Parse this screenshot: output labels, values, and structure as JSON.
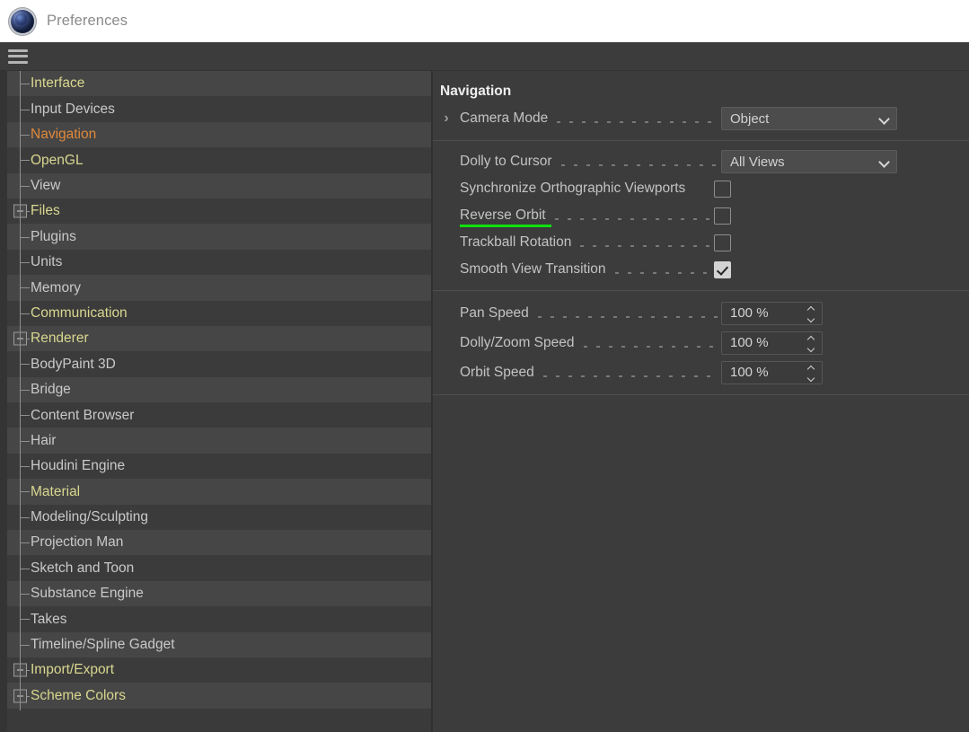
{
  "window": {
    "title": "Preferences",
    "logo_icon": "cinema4d-sphere-icon",
    "menu_icon": "hamburger-menu-icon"
  },
  "sidebar": {
    "items": [
      {
        "label": "Interface",
        "color_class": "c-yellow",
        "expandable": false,
        "selected": false
      },
      {
        "label": "Input Devices",
        "color_class": "c-plain",
        "expandable": false,
        "selected": false
      },
      {
        "label": "Navigation",
        "color_class": "c-sel",
        "expandable": false,
        "selected": true
      },
      {
        "label": "OpenGL",
        "color_class": "c-yellow",
        "expandable": false,
        "selected": false
      },
      {
        "label": "View",
        "color_class": "c-plain",
        "expandable": false,
        "selected": false
      },
      {
        "label": "Files",
        "color_class": "c-yellow",
        "expandable": true,
        "selected": false
      },
      {
        "label": "Plugins",
        "color_class": "c-plain",
        "expandable": false,
        "selected": false
      },
      {
        "label": "Units",
        "color_class": "c-plain",
        "expandable": false,
        "selected": false
      },
      {
        "label": "Memory",
        "color_class": "c-plain",
        "expandable": false,
        "selected": false
      },
      {
        "label": "Communication",
        "color_class": "c-yellow",
        "expandable": false,
        "selected": false
      },
      {
        "label": "Renderer",
        "color_class": "c-yellow",
        "expandable": true,
        "selected": false
      },
      {
        "label": "BodyPaint 3D",
        "color_class": "c-plain",
        "expandable": false,
        "selected": false
      },
      {
        "label": "Bridge",
        "color_class": "c-plain",
        "expandable": false,
        "selected": false
      },
      {
        "label": "Content Browser",
        "color_class": "c-plain",
        "expandable": false,
        "selected": false
      },
      {
        "label": "Hair",
        "color_class": "c-plain",
        "expandable": false,
        "selected": false
      },
      {
        "label": "Houdini Engine",
        "color_class": "c-plain",
        "expandable": false,
        "selected": false
      },
      {
        "label": "Material",
        "color_class": "c-yellow",
        "expandable": false,
        "selected": false
      },
      {
        "label": "Modeling/Sculpting",
        "color_class": "c-plain",
        "expandable": false,
        "selected": false
      },
      {
        "label": "Projection Man",
        "color_class": "c-plain",
        "expandable": false,
        "selected": false
      },
      {
        "label": "Sketch and Toon",
        "color_class": "c-plain",
        "expandable": false,
        "selected": false
      },
      {
        "label": "Substance Engine",
        "color_class": "c-plain",
        "expandable": false,
        "selected": false
      },
      {
        "label": "Takes",
        "color_class": "c-plain",
        "expandable": false,
        "selected": false
      },
      {
        "label": "Timeline/Spline Gadget",
        "color_class": "c-plain",
        "expandable": false,
        "selected": false
      },
      {
        "label": "Import/Export",
        "color_class": "c-yellow",
        "expandable": true,
        "selected": false
      },
      {
        "label": "Scheme Colors",
        "color_class": "c-yellow",
        "expandable": true,
        "selected": false
      }
    ]
  },
  "panel": {
    "heading": "Navigation",
    "camera_mode": {
      "label": "Camera Mode",
      "value": "Object",
      "expand_icon": "chevron-right-icon",
      "dropdown_icon": "chevron-down-icon"
    },
    "group_views": [
      {
        "label": "Dolly to Cursor",
        "control": "dropdown",
        "value": "All Views",
        "dropdown_icon": "chevron-down-icon",
        "leader": true,
        "highlight": false
      },
      {
        "label": "Synchronize Orthographic Viewports",
        "control": "checkbox",
        "checked": false,
        "leader": false,
        "highlight": false
      },
      {
        "label": "Reverse Orbit",
        "control": "checkbox",
        "checked": false,
        "leader": true,
        "highlight": true
      },
      {
        "label": "Trackball Rotation",
        "control": "checkbox",
        "checked": false,
        "leader": true,
        "highlight": false
      },
      {
        "label": "Smooth View Transition",
        "control": "checkbox",
        "checked": true,
        "leader": true,
        "highlight": false
      }
    ],
    "group_speeds": [
      {
        "label": "Pan Speed",
        "value": "100 %",
        "spinner_icon": "spinner-updown-icon"
      },
      {
        "label": "Dolly/Zoom Speed",
        "value": "100 %",
        "spinner_icon": "spinner-updown-icon"
      },
      {
        "label": "Orbit Speed",
        "value": "100 %",
        "spinner_icon": "spinner-updown-icon"
      }
    ]
  },
  "colors": {
    "titlebar_bg": "#ffffff",
    "panel_bg": "#3c3c3c",
    "row_odd": "#464646",
    "row_even": "#3b3b3b",
    "accent_selected": "#e0893a",
    "accent_yellow": "#d9d78f",
    "highlight_underline": "#0fe00f"
  }
}
